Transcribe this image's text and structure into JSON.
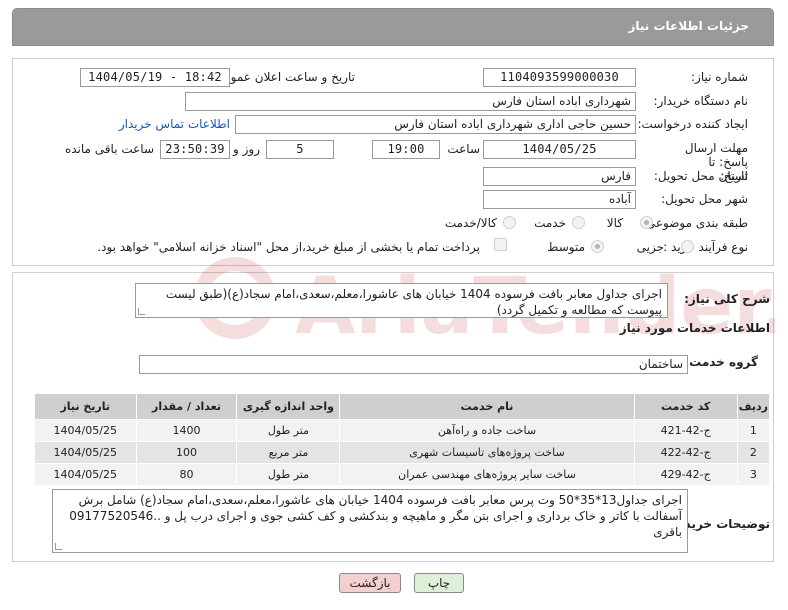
{
  "header": {
    "title": "جزئیات اطلاعات نیاز"
  },
  "form": {
    "need_number_label": "شماره نیاز:",
    "need_number": "1104093599000030",
    "announce_label": "تاریخ و ساعت اعلان عمومی:",
    "announce_value": "1404/05/19 - 18:42",
    "buyer_org_label": "نام دستگاه خریدار:",
    "buyer_org": "شهرداری اباده استان فارس",
    "requester_label": "ایجاد کننده درخواست:",
    "requester": "حسین حاجی اداری شهرداری اباده استان فارس",
    "contact_link": "اطلاعات تماس خریدار",
    "deadline_label": "مهلت ارسال پاسخ: تا تاریخ:",
    "deadline_date": "1404/05/25",
    "time_label": "ساعت",
    "deadline_time": "19:00",
    "days_value": "5",
    "days_label": "روز و",
    "remaining_time": "23:50:39",
    "remaining_label": "ساعت باقی مانده",
    "province_label": "استان محل تحویل:",
    "province": "فارس",
    "city_label": "شهر محل تحویل:",
    "city": "آباده",
    "category_label": "طبقه بندی موضوعی:",
    "category_options": [
      "کالا",
      "خدمت",
      "کالا/خدمت"
    ],
    "purchase_type_label": "نوع فرآیند خرید :",
    "purchase_options": [
      "جزیی",
      "متوسط"
    ],
    "treasury_note": "پرداخت تمام یا بخشی از مبلغ خرید،از محل \"اسناد خزانه اسلامی\" خواهد بود."
  },
  "summary": {
    "label": "شرح کلی نیاز:",
    "text": "اجرای جداول معابر بافت فرسوده 1404 خیابان های عاشورا،معلم،سعدی،امام سجاد(ع)(طبق لیست پیوست که مطالعه و تکمیل گردد)"
  },
  "services": {
    "section_title": "اطلاعات خدمات مورد نیاز",
    "group_label": "گروه خدمت:",
    "group_value": "ساختمان",
    "columns": [
      "ردیف",
      "کد خدمت",
      "نام خدمت",
      "واحد اندازه گیری",
      "تعداد / مقدار",
      "تاریخ نیاز"
    ],
    "rows": [
      [
        "1",
        "ج-42-421",
        "ساخت جاده و راه‌آهن",
        "متر طول",
        "1400",
        "1404/05/25"
      ],
      [
        "2",
        "ج-42-422",
        "ساخت پروژه‌های تاسیسات شهری",
        "متر مربع",
        "100",
        "1404/05/25"
      ],
      [
        "3",
        "ج-42-429",
        "ساخت سایر پروژه‌های مهندسی عمران",
        "متر طول",
        "80",
        "1404/05/25"
      ]
    ]
  },
  "buyer_notes": {
    "label": "توضیحات خریدار:",
    "text": "اجرای جداول13*35*50 وت پرس معابر بافت فرسوده 1404 خیابان های عاشورا،معلم،سعدی،امام سجاد(ع) شامل برش آسفالت با کاتر و خاک برداری و اجرای بتن مگر و ماهیچه و بندکشی و کف کشی جوی و اجرای درب پل و ..09177520546 باقری"
  },
  "buttons": {
    "print": "چاپ",
    "back": "بازگشت"
  },
  "watermark": {
    "text": "AriaTender.net"
  },
  "colors": {
    "header": "#9a9a9a",
    "link": "#1a56c4",
    "back_button": "#f4cfcf",
    "print_button": "#dff0d8"
  }
}
